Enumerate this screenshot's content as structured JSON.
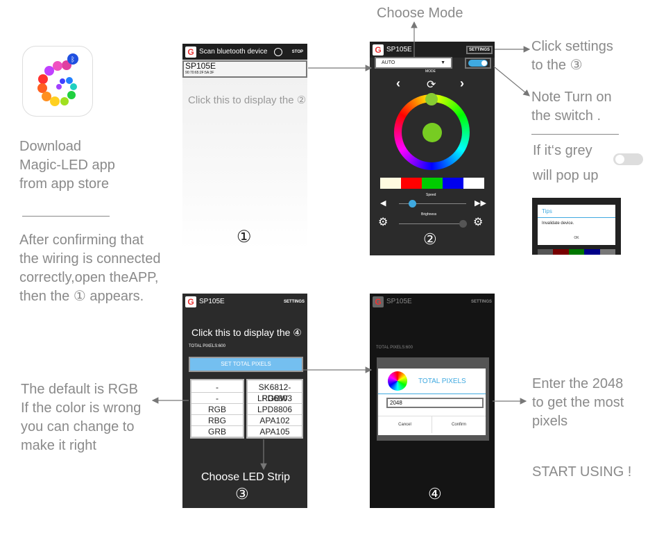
{
  "left": {
    "download": [
      "Download",
      "Magic-LED app",
      "from app  store"
    ],
    "confirm": [
      "After confirming that",
      "the wiring is connected",
      "correctly,open theAPP,",
      "then the ① appears."
    ],
    "default_rgb": [
      "The default is RGB",
      "If the color is wrong",
      "you can change to",
      "make it right"
    ]
  },
  "top_label": "Choose Mode",
  "right": {
    "settings_note": [
      "Click settings",
      "to the ③"
    ],
    "switch_note": [
      "Note Turn on",
      "the switch ."
    ],
    "grey_note": [
      "If it‘s grey",
      "will pop up"
    ],
    "enter_note": [
      "Enter the 2048",
      "to get the most",
      "pixels"
    ],
    "start": "START USING !"
  },
  "screen1": {
    "title": "Scan bluetooth device",
    "stop": "STOP",
    "device_name": "SP105E",
    "device_mac": "90:70:65:2F:5A:3F",
    "hint": "Click this to display the ②",
    "badge": "①"
  },
  "screen2": {
    "title": "SP105E",
    "settings": "SETTINGS",
    "mode_value": "AUTO",
    "mode_label": "MODE",
    "speed_label": "Speed",
    "brightness_label": "Brighness",
    "swatches": [
      "#fffbe0",
      "#ff0000",
      "#00cc00",
      "#0000ee",
      "#ffffff"
    ],
    "speed": 0.2,
    "brightness": 0.95,
    "toggle_on": true,
    "badge": "②"
  },
  "tips_popup": {
    "title": "Tips",
    "message": "Invalidate device.",
    "ok": "OK"
  },
  "screen3": {
    "title": "SP105E",
    "settings": "SETTINGS",
    "hint": "Click this to display the ④",
    "total_pixels": "TOTAL PIXELS:600",
    "set_button": "SET TOTAL PIXELS",
    "color_orders": [
      "-",
      "-",
      "RGB",
      "RBG",
      "GRB"
    ],
    "strips": [
      "SK6812-RGBW",
      "LPD6803",
      "LPD8806",
      "APA102",
      "APA105"
    ],
    "caption": "Choose LED Strip",
    "badge": "③"
  },
  "screen4": {
    "title": "SP105E",
    "settings": "SETTINGS",
    "total_pixels": "TOTAL PIXELS:600",
    "dialog_title": "TOTAL PIXELS",
    "input_value": "2048",
    "cancel": "Cancel",
    "confirm": "Confirm",
    "badge": "④"
  },
  "colors": {
    "accent": "#3fa9e0",
    "note_text": "#8a8a8a",
    "phone_bg": "#2b2b2b"
  }
}
